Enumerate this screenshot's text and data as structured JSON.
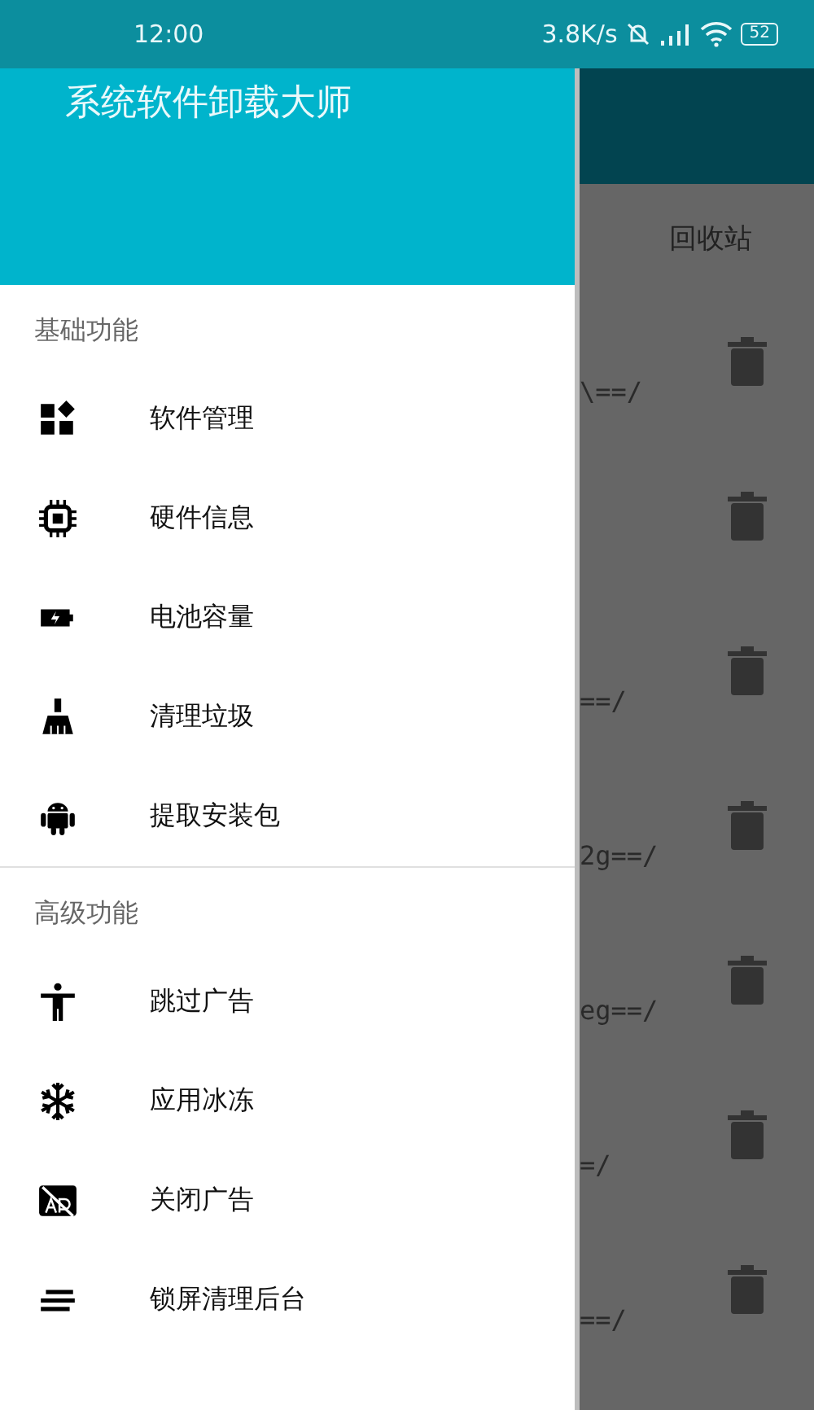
{
  "status_bar": {
    "time": "12:00",
    "net_speed": "3.8K/s",
    "battery": "52"
  },
  "drawer": {
    "title": "系统软件卸载大师",
    "sections": [
      {
        "header": "基础功能",
        "items": [
          {
            "label": "软件管理",
            "kind": "apps"
          },
          {
            "label": "硬件信息",
            "kind": "chip"
          },
          {
            "label": "电池容量",
            "kind": "battery"
          },
          {
            "label": "清理垃圾",
            "kind": "broom"
          },
          {
            "label": "提取安装包",
            "kind": "android"
          }
        ]
      },
      {
        "header": "高级功能",
        "items": [
          {
            "label": "跳过广告",
            "kind": "person"
          },
          {
            "label": "应用冰冻",
            "kind": "snow"
          },
          {
            "label": "关闭广告",
            "kind": "adoff"
          },
          {
            "label": "锁屏清理后台",
            "kind": "lines"
          }
        ]
      }
    ]
  },
  "background": {
    "tab": "回收站",
    "rows": [
      {
        "text": "\\==/"
      },
      {
        "text": ""
      },
      {
        "text": "==/"
      },
      {
        "text": "2g==/"
      },
      {
        "text": "eg==/"
      },
      {
        "text": "=/"
      },
      {
        "text": "==/"
      }
    ]
  }
}
